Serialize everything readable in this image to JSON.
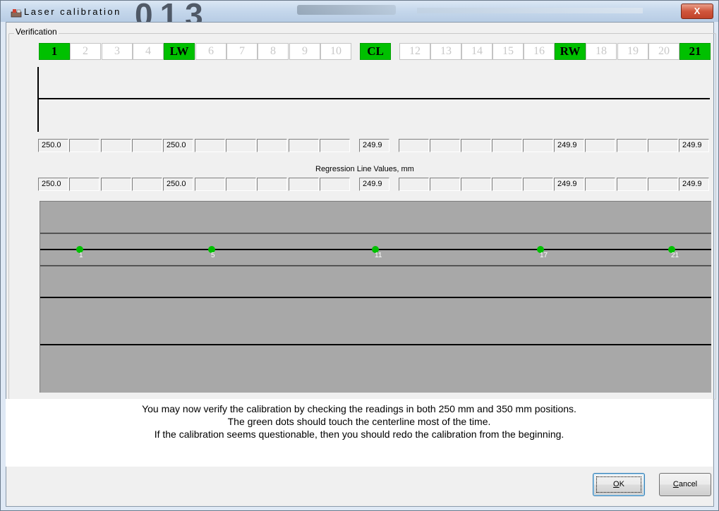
{
  "window": {
    "title": "Laser calibration",
    "title_deco_text": "013",
    "close_label": "X"
  },
  "group": {
    "label": "Verification"
  },
  "positions": [
    {
      "label": "1",
      "active": true
    },
    {
      "label": "2",
      "active": false
    },
    {
      "label": "3",
      "active": false
    },
    {
      "label": "4",
      "active": false
    },
    {
      "label": "LW",
      "active": true
    },
    {
      "label": "6",
      "active": false
    },
    {
      "label": "7",
      "active": false
    },
    {
      "label": "8",
      "active": false
    },
    {
      "label": "9",
      "active": false
    },
    {
      "label": "10",
      "active": false
    },
    {
      "label": "CL",
      "active": true
    },
    {
      "label": "12",
      "active": false
    },
    {
      "label": "13",
      "active": false
    },
    {
      "label": "14",
      "active": false
    },
    {
      "label": "15",
      "active": false
    },
    {
      "label": "16",
      "active": false
    },
    {
      "label": "RW",
      "active": true
    },
    {
      "label": "18",
      "active": false
    },
    {
      "label": "19",
      "active": false
    },
    {
      "label": "20",
      "active": false
    },
    {
      "label": "21",
      "active": true
    }
  ],
  "measured_values": [
    "250.0",
    "",
    "",
    "",
    "250.0",
    "",
    "",
    "",
    "",
    "",
    "249.9",
    "",
    "",
    "",
    "",
    "",
    "249.9",
    "",
    "",
    "",
    "249.9"
  ],
  "regression": {
    "label": "Regression Line Values,    mm",
    "values": [
      "250.0",
      "",
      "",
      "",
      "250.0",
      "",
      "",
      "",
      "",
      "",
      "249.9",
      "",
      "",
      "",
      "",
      "",
      "249.9",
      "",
      "",
      "",
      "249.9"
    ]
  },
  "chart_data": {
    "type": "scatter",
    "points": [
      {
        "label": "1"
      },
      {
        "label": "5"
      },
      {
        "label": "11"
      },
      {
        "label": "17"
      },
      {
        "label": "21"
      }
    ],
    "dot_color": "#00c000",
    "background": "#a8a8a8"
  },
  "info": {
    "line1": "You may now verify the calibration by checking the readings in both 250 mm and 350 mm positions.",
    "line2": "The green dots should touch the centerline most of the time.",
    "line3": "If the calibration seems questionable, then you should redo the calibration from the beginning."
  },
  "buttons": {
    "ok_accel": "O",
    "ok_rest": "K",
    "cancel_accel": "C",
    "cancel_rest": "ancel"
  },
  "colors": {
    "active_green": "#00c000",
    "chart_grey": "#a8a8a8"
  }
}
